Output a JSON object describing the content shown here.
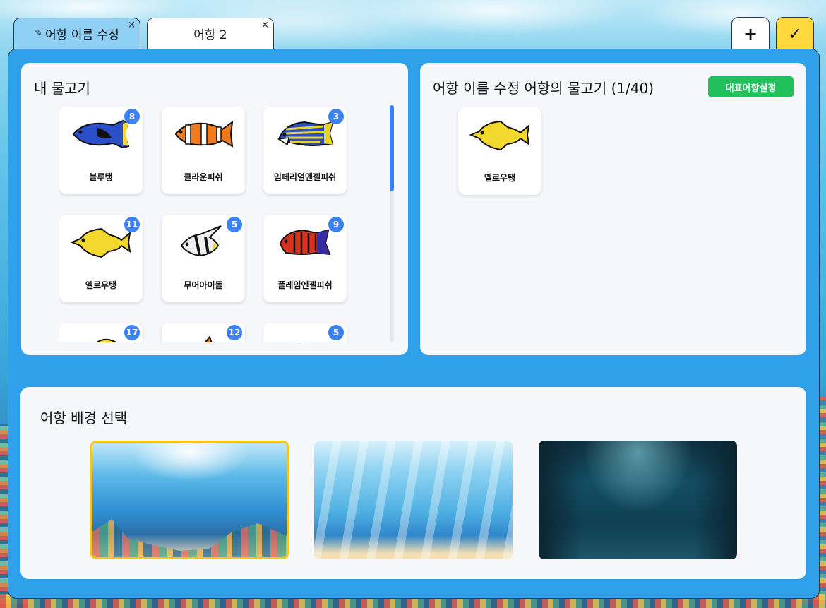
{
  "tabs": [
    {
      "label": "어항 이름 수정",
      "active": true,
      "icon": "pencil-icon"
    },
    {
      "label": "어항 2",
      "active": false
    }
  ],
  "close_glyph": "×",
  "actions": {
    "add_label": "+",
    "confirm_label": "✓"
  },
  "my_fish": {
    "title": "내 물고기",
    "items": [
      {
        "name": "블루탱",
        "count": "8",
        "color": "#2a4fc9"
      },
      {
        "name": "클라운피쉬",
        "count": "",
        "color": "#f07a1e"
      },
      {
        "name": "임페리얼엔젤피쉬",
        "count": "3",
        "color": "#e8d32a"
      },
      {
        "name": "옐로우탱",
        "count": "11",
        "color": "#f2d82c"
      },
      {
        "name": "무어아이돌",
        "count": "5",
        "color": "#f0f0f0"
      },
      {
        "name": "플레임엔젤피쉬",
        "count": "9",
        "color": "#d8321e"
      },
      {
        "name": "",
        "count": "17",
        "color": "#f2d82c"
      },
      {
        "name": "",
        "count": "12",
        "color": "#f07a1e"
      },
      {
        "name": "",
        "count": "5",
        "color": "#d7e6f2"
      }
    ]
  },
  "tank_fish": {
    "title": "어항 이름 수정 어항의 물고기 (1/40)",
    "rep_button": "대표어항설정",
    "items": [
      {
        "name": "옐로우탱",
        "color": "#f2d82c"
      }
    ]
  },
  "backgrounds": {
    "title": "어항 배경 선택",
    "selected_index": 0
  }
}
